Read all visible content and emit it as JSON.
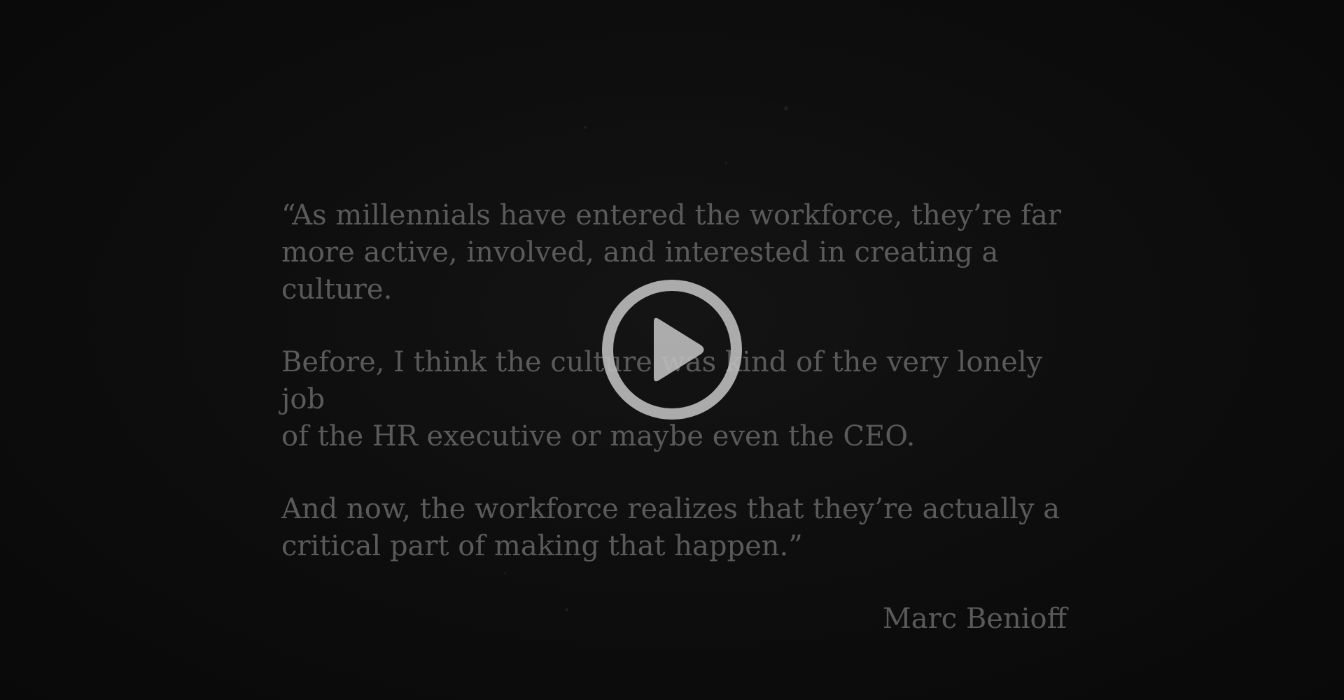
{
  "video": {
    "quote_paragraphs": [
      "“As millennials have entered the workforce, they’re far\nmore active, involved, and interested in creating a culture.",
      "Before, I think the culture was kind of the very lonely job\nof the HR executive or maybe even the CEO.",
      "And now, the workforce realizes that they’re actually a\ncritical part of making that happen.”"
    ],
    "attribution": "Marc Benioff",
    "play_icon": "play-icon",
    "colors": {
      "background": "#0b0b0b",
      "text": "#5a5a5a",
      "play_button": "#bdbdbd"
    }
  }
}
